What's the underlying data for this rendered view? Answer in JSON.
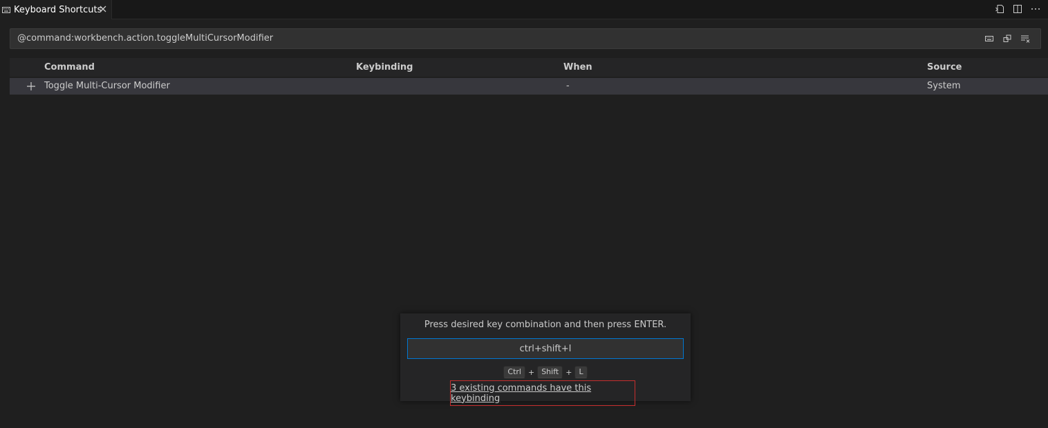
{
  "tab": {
    "title": "Keyboard Shortcuts"
  },
  "search": {
    "value": "@command:workbench.action.toggleMultiCursorModifier"
  },
  "table": {
    "headers": {
      "command": "Command",
      "keybinding": "Keybinding",
      "when": "When",
      "source": "Source"
    },
    "rows": [
      {
        "command": "Toggle Multi-Cursor Modifier",
        "keybinding": "",
        "when": "-",
        "source": "System"
      }
    ]
  },
  "dialog": {
    "message": "Press desired key combination and then press ENTER.",
    "input_value": "ctrl+shift+l",
    "keys": [
      "Ctrl",
      "Shift",
      "L"
    ],
    "separator": "+",
    "conflict_text": "3 existing commands have this keybinding"
  },
  "colors": {
    "accent": "#0078d4",
    "conflict_border": "#c72e2e",
    "background": "#1f1f1f"
  }
}
